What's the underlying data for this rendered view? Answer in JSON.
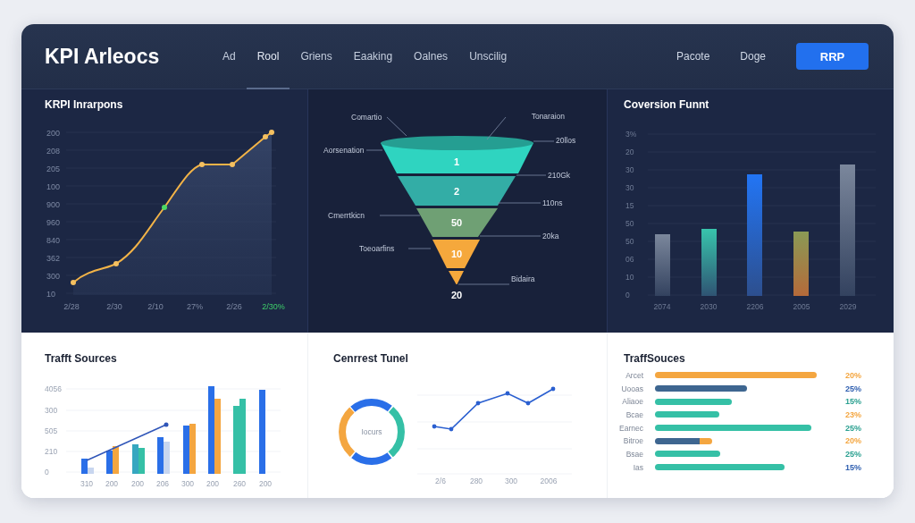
{
  "header": {
    "title": "KPI Arleocs",
    "tabs": [
      {
        "label": "Ad",
        "selected": false
      },
      {
        "label": "Rool",
        "selected": true
      },
      {
        "label": "Griens",
        "selected": false
      },
      {
        "label": "Eaaking",
        "selected": false
      },
      {
        "label": "Oalnes",
        "selected": false
      },
      {
        "label": "Unscilig",
        "selected": false
      }
    ],
    "links": [
      "Pacote",
      "Doge"
    ],
    "button": "RRP"
  },
  "line_panel": {
    "title": "KRPI Inrarpons",
    "y_labels": [
      "200",
      "208",
      "205",
      "100",
      "900",
      "960",
      "840",
      "362",
      "300",
      "10"
    ],
    "x_labels": [
      {
        "text": "2/28",
        "highlighted": false
      },
      {
        "text": "2/30",
        "highlighted": false
      },
      {
        "text": "2/10",
        "highlighted": false
      },
      {
        "text": "27%",
        "highlighted": false
      },
      {
        "text": "2/26",
        "highlighted": false
      },
      {
        "text": "2/30%",
        "highlighted": true
      }
    ]
  },
  "funnel_panel": {
    "stages": [
      {
        "label": "1",
        "color": "#2fd4c0"
      },
      {
        "label": "2",
        "color": "#33ada6"
      },
      {
        "label": "50",
        "color": "#6fa074"
      },
      {
        "label": "10",
        "color": "#f5a83c"
      },
      {
        "color": "#f5a83c"
      }
    ],
    "bottom_label": "20",
    "callouts": [
      "Comartio",
      "Tonaraion",
      "20llos",
      "Aorsenation",
      "210Gk",
      "110ns",
      "Cmerrtkicn",
      "20ka",
      "Toeoarfins",
      "Bidaira"
    ]
  },
  "bar_panel": {
    "title": "Coversion Funnt",
    "y_labels": [
      "3%",
      "20",
      "30",
      "30",
      "15",
      "50",
      "50",
      "06",
      "10",
      "0"
    ],
    "x_labels": [
      "2074",
      "2030",
      "2206",
      "2005",
      "2029"
    ]
  },
  "traffic_panel": {
    "title": "Trafft Sources",
    "y_labels": [
      "4056",
      "300",
      "505",
      "210",
      "0"
    ],
    "x_labels": [
      "310",
      "200",
      "200",
      "206",
      "300",
      "200",
      "260",
      "200"
    ]
  },
  "donut_panel": {
    "title": "Cenrrest Tunel",
    "center_label": "Iocurs",
    "x_labels": [
      "2/6",
      "280",
      "300",
      "2006"
    ]
  },
  "sources_panel": {
    "title": "TraffSouces",
    "rows": [
      {
        "label": "Arcet",
        "segments": [
          {
            "color": "#f4a640"
          }
        ],
        "value": {
          "text": "20%",
          "color": "#f4a640"
        }
      },
      {
        "label": "Uooas",
        "segments": [
          {
            "color": "#3e6690"
          }
        ],
        "value": {
          "text": "25%",
          "color": "#2f5fb0"
        }
      },
      {
        "label": "Aliaoe",
        "segments": [
          {
            "color": "#35c0a6"
          }
        ],
        "value": {
          "text": "15%",
          "color": "#2aa090"
        }
      },
      {
        "label": "Bcae",
        "segments": [
          {
            "color": "#35c0a6"
          }
        ],
        "value": {
          "text": "23%",
          "color": "#f4a640"
        }
      },
      {
        "label": "Earnec",
        "segments": [
          {
            "color": "#35c0a6"
          }
        ],
        "value": {
          "text": "25%",
          "color": "#2aa090"
        }
      },
      {
        "label": "Bitroe",
        "segments": [
          {
            "color": "#3e6690"
          },
          {
            "color": "#f4a640"
          }
        ],
        "value": {
          "text": "20%",
          "color": "#f4a640"
        }
      },
      {
        "label": "Bsae",
        "segments": [
          {
            "color": "#35c0a6"
          }
        ],
        "value": {
          "text": "25%",
          "color": "#2aa090"
        }
      },
      {
        "label": "Ias",
        "segments": [
          {
            "color": "#35c0a6"
          }
        ],
        "value": {
          "text": "15%",
          "color": "#2f5fb0"
        }
      }
    ]
  }
}
